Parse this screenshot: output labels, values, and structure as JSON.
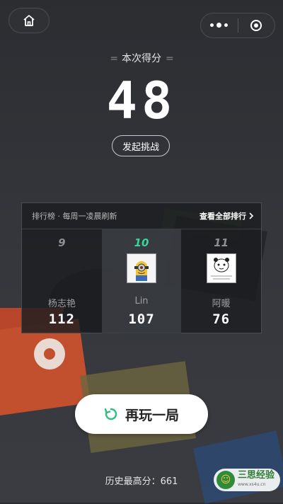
{
  "header": {
    "home_icon": "home-icon",
    "menu_icon": "more-dots-icon",
    "close_icon": "target-close-icon"
  },
  "score": {
    "label": "本次得分",
    "value": "48"
  },
  "challenge_button": "发起挑战",
  "leaderboard": {
    "title": "排行榜 · 每周一凌晨刷新",
    "view_all": "查看全部排行",
    "entries": [
      {
        "rank": "9",
        "name": "杨志艳",
        "score": "112",
        "current": false
      },
      {
        "rank": "10",
        "name": "Lin",
        "score": "107",
        "current": true
      },
      {
        "rank": "11",
        "name": "阿暖",
        "score": "76",
        "current": false
      }
    ]
  },
  "replay_button": "再玩一局",
  "best_score": "历史最高分：661",
  "watermark": {
    "name": "三思经验",
    "url": "www.xs4u.cn"
  },
  "colors": {
    "accent_green": "#3ad39a",
    "background": "#2b2d31"
  }
}
